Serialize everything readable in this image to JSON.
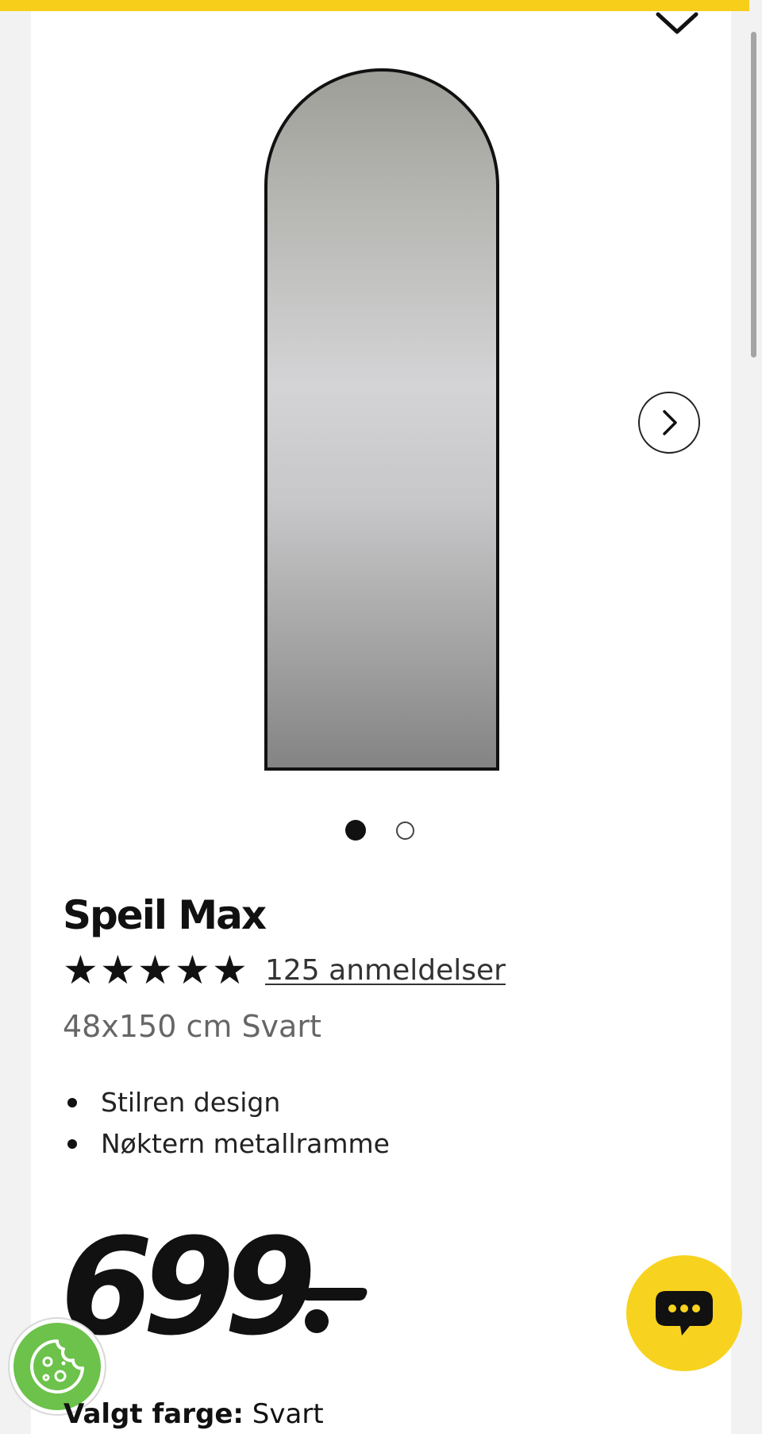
{
  "colors": {
    "accent_yellow": "#f7cf1a",
    "cookie_green": "#6cc24a",
    "text_dark": "#111111",
    "text_muted": "#666666"
  },
  "icons": {
    "wishlist": "chevron-down-icon",
    "next": "chevron-right-icon",
    "chat": "chat-bubble-icon",
    "cookie": "cookie-icon"
  },
  "gallery": {
    "image_count": 2,
    "active_index": 0
  },
  "product": {
    "name": "Speil Max",
    "rating_stars": 5,
    "reviews_label": "125 anmeldelser",
    "variant": "48x150 cm Svart",
    "features": [
      "Stilren design",
      "Nøktern metallramme"
    ],
    "price": "699"
  },
  "selection": {
    "color_label": "Valgt farge:",
    "color_value": "Svart"
  }
}
